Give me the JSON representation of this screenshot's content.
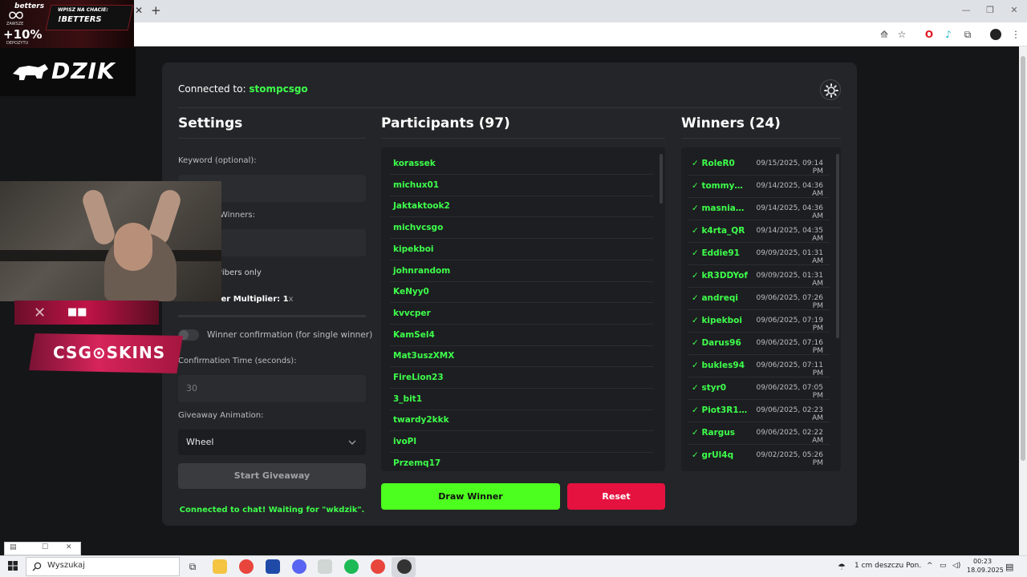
{
  "browser": {
    "window_controls": [
      "minimize",
      "restore",
      "close"
    ]
  },
  "overlay": {
    "ad_brand": "betters",
    "ad_percent": "+10%",
    "ad_small_top": "ZAWSZE",
    "ad_small_bottom": "DEPOZYTU",
    "ad_cta_line1": "WPISZ NA CHACIE:",
    "ad_cta_line2": "!BETTERS",
    "streamer_logo": "DZIK",
    "sponsor_logo": "CSG⊙SKINS"
  },
  "header": {
    "connected_prefix": "Connected to:",
    "channel": "stompcsgo"
  },
  "settings": {
    "title": "Settings",
    "keyword_label": "Keyword (optional):",
    "keyword_value": "",
    "winners_label": "Winners:",
    "winners_value": "",
    "subscribers_label": "scribers only",
    "multiplier_label": "riber Multiplier: 1",
    "multiplier_suffix": "x",
    "winner_confirmation_label": "Winner confirmation (for single winner)",
    "confirmation_time_label": "Confirmation Time (seconds):",
    "confirmation_time_value": "30",
    "animation_label": "Giveaway Animation:",
    "animation_value": "Wheel",
    "start_button": "Start Giveaway",
    "status": "Connected to chat! Waiting for \"wkdzik\"."
  },
  "participants": {
    "title": "Participants (97)",
    "items": [
      "korassek",
      "michux01",
      "Jaktaktook2",
      "michvcsgo",
      "kipekboi",
      "johnrandom",
      "KeNyy0",
      "kvvcper",
      "KamSel4",
      "Mat3uszXMX",
      "FireLion23",
      "3_bit1",
      "twardy2kkk",
      "ivoPl",
      "Przemq17"
    ],
    "draw_button": "Draw Winner",
    "reset_button": "Reset"
  },
  "winners": {
    "title": "Winners (24)",
    "items": [
      {
        "name": "✓ RoleR0",
        "date": "09/15/2025, 09:14 PM"
      },
      {
        "name": "✓ tommye...",
        "date": "09/14/2025, 04:36 AM"
      },
      {
        "name": "✓ masniak...",
        "date": "09/14/2025, 04:36 AM"
      },
      {
        "name": "✓ k4rta_QR",
        "date": "09/14/2025, 04:35 AM"
      },
      {
        "name": "✓ Eddie91",
        "date": "09/09/2025, 01:31 AM"
      },
      {
        "name": "✓ kR3DDYof",
        "date": "09/09/2025, 01:31 AM"
      },
      {
        "name": "✓ andreqi",
        "date": "09/06/2025, 07:26 PM"
      },
      {
        "name": "✓ kipekboi",
        "date": "09/06/2025, 07:19 PM"
      },
      {
        "name": "✓ Darus96",
        "date": "09/06/2025, 07:16 PM"
      },
      {
        "name": "✓ bukles94",
        "date": "09/06/2025, 07:11 PM"
      },
      {
        "name": "✓ styr0",
        "date": "09/06/2025, 07:05 PM"
      },
      {
        "name": "✓ Piot3R13...",
        "date": "09/06/2025, 02:23 AM"
      },
      {
        "name": "✓ Rargus",
        "date": "09/06/2025, 02:22 AM"
      },
      {
        "name": "✓ grUl4q",
        "date": "09/02/2025, 05:26 PM"
      }
    ]
  },
  "taskbar": {
    "search_placeholder": "Wyszukaj",
    "weather": "1 cm deszczu Pon.",
    "time": "00:23",
    "date": "18.09.2025"
  },
  "colors": {
    "accent_green": "#3dff4b",
    "draw_green": "#4dff1f",
    "reset_red": "#e5123f",
    "panel_bg": "#242528"
  }
}
